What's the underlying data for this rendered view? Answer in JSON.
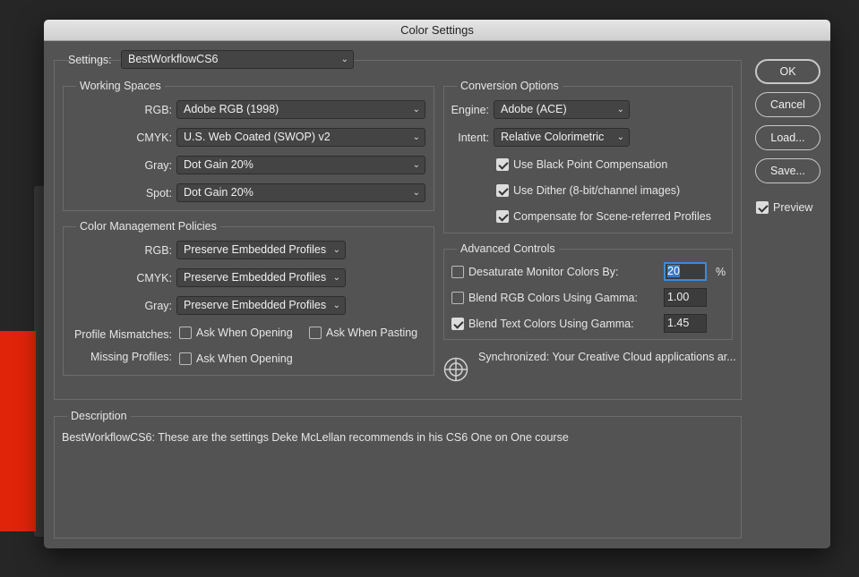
{
  "window": {
    "title": "Color Settings"
  },
  "settings": {
    "label": "Settings:",
    "value": "BestWorkflowCS6"
  },
  "working_spaces": {
    "title": "Working Spaces",
    "rgb": {
      "label": "RGB:",
      "value": "Adobe RGB (1998)"
    },
    "cmyk": {
      "label": "CMYK:",
      "value": "U.S. Web Coated (SWOP) v2"
    },
    "gray": {
      "label": "Gray:",
      "value": "Dot Gain 20%"
    },
    "spot": {
      "label": "Spot:",
      "value": "Dot Gain 20%"
    }
  },
  "policies": {
    "title": "Color Management Policies",
    "rgb": {
      "label": "RGB:",
      "value": "Preserve Embedded Profiles"
    },
    "cmyk": {
      "label": "CMYK:",
      "value": "Preserve Embedded Profiles"
    },
    "gray": {
      "label": "Gray:",
      "value": "Preserve Embedded Profiles"
    },
    "mismatches": {
      "label": "Profile Mismatches:",
      "ask_opening": "Ask When Opening",
      "ask_pasting": "Ask When Pasting",
      "ask_opening_checked": false,
      "ask_pasting_checked": false
    },
    "missing": {
      "label": "Missing Profiles:",
      "ask_opening": "Ask When Opening",
      "ask_opening_checked": false
    }
  },
  "conversion": {
    "title": "Conversion Options",
    "engine": {
      "label": "Engine:",
      "value": "Adobe (ACE)"
    },
    "intent": {
      "label": "Intent:",
      "value": "Relative Colorimetric"
    },
    "black_point": {
      "label": "Use Black Point Compensation",
      "checked": true
    },
    "dither": {
      "label": "Use Dither (8-bit/channel images)",
      "checked": true
    },
    "scene_referred": {
      "label": "Compensate for Scene-referred Profiles",
      "checked": true
    }
  },
  "advanced": {
    "title": "Advanced Controls",
    "desaturate": {
      "label": "Desaturate Monitor Colors By:",
      "value": "20",
      "unit": "%",
      "checked": false
    },
    "blend_rgb": {
      "label": "Blend RGB Colors Using Gamma:",
      "value": "1.00",
      "checked": false
    },
    "blend_text": {
      "label": "Blend Text Colors Using Gamma:",
      "value": "1.45",
      "checked": true
    }
  },
  "sync": {
    "text": "Synchronized: Your Creative Cloud applications ar...",
    "icon": "sync-target-icon"
  },
  "description": {
    "title": "Description",
    "text": "BestWorkflowCS6:  These are the settings Deke McLellan recommends in his CS6 One on One course"
  },
  "buttons": {
    "ok": "OK",
    "cancel": "Cancel",
    "load": "Load...",
    "save": "Save..."
  },
  "preview": {
    "label": "Preview",
    "checked": true
  },
  "colors": {
    "dialog_bg": "#535353",
    "focus_ring": "#3b8ad8",
    "background_red": "#e0240a"
  }
}
